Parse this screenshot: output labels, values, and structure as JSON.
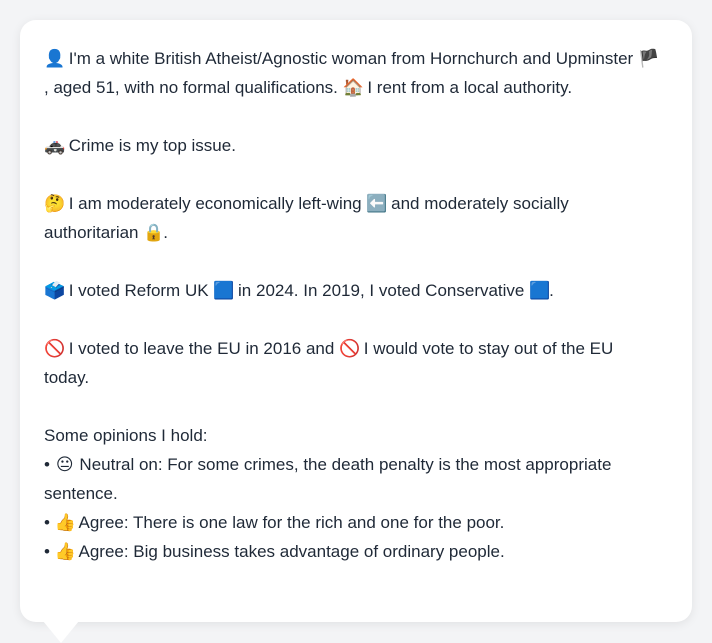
{
  "profile": {
    "intro": {
      "icon": "👤",
      "text1": "I'm a white British Atheist/Agnostic woman from Hornchurch and Upminster",
      "flag": "🏴",
      "text2": ", aged 51, with no formal qualifications.",
      "house": "🏠",
      "text3": "I rent from a local authority."
    },
    "issue": {
      "icon": "🚓",
      "text": "Crime is my top issue."
    },
    "ideology": {
      "icon": "🤔",
      "text1": "I am moderately economically left-wing",
      "left": "⬅️",
      "text2": "and moderately socially authoritarian",
      "lock": "🔒",
      "text3": "."
    },
    "vote": {
      "icon": "🗳️",
      "text1": "I voted Reform UK",
      "sq1": "🟦",
      "text2": "in 2024. In 2019, I voted Conservative",
      "sq2": "🟦",
      "text3": "."
    },
    "eu": {
      "icon1": "🚫",
      "text1": "I voted to leave the EU in 2016 and",
      "icon2": "🚫",
      "text2": "I would vote to stay out of the EU today."
    },
    "opinions_heading": "Some opinions I hold:",
    "opinions": [
      {
        "bullet": "•",
        "icon": "😐",
        "text": "Neutral on: For some crimes, the death penalty is the most appropriate sentence."
      },
      {
        "bullet": "•",
        "icon": "👍",
        "text": "Agree: There is one law for the rich and one for the poor."
      },
      {
        "bullet": "•",
        "icon": "👍",
        "text": "Agree: Big business takes advantage of ordinary people."
      }
    ]
  }
}
